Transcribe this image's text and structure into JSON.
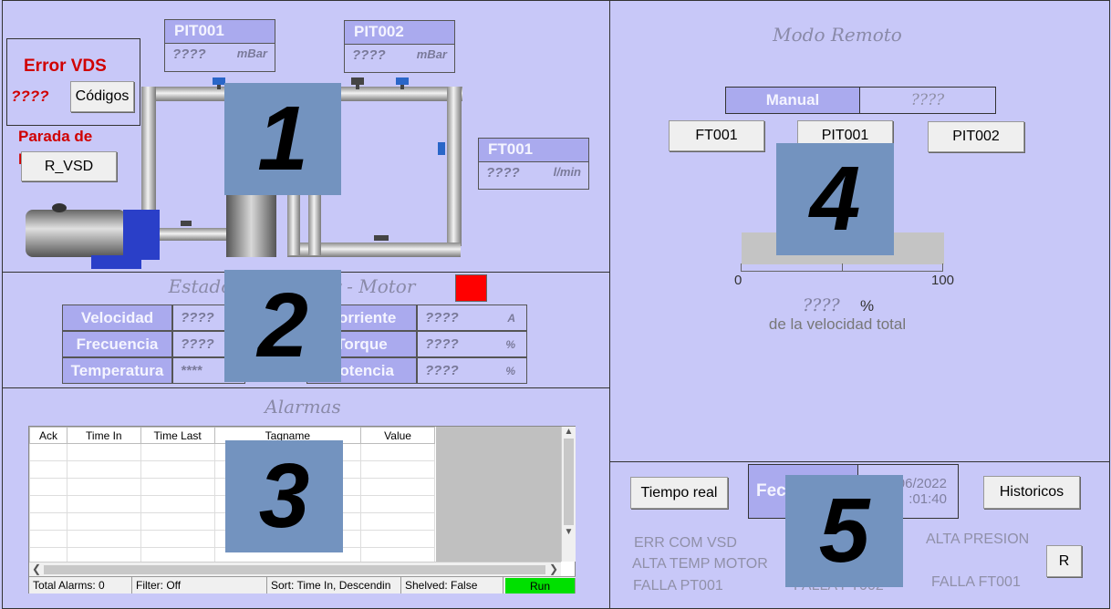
{
  "sections": {
    "motor_status_title": "Estado — Variador - Motor",
    "alarms_title": "Alarmas",
    "remote_mode_title": "Modo Remoto"
  },
  "error": {
    "title": "Error VDS",
    "value": "????",
    "codes_button": "Códigos",
    "stop_text": "Parada de Emergencia",
    "reset_button": "R_VSD"
  },
  "tags": {
    "pit001": {
      "name": "PIT001",
      "value": "????",
      "unit": "mBar"
    },
    "pit002": {
      "name": "PIT002",
      "value": "????",
      "unit": "mBar"
    },
    "ft001": {
      "name": "FT001",
      "value": "????",
      "unit": "l/min"
    }
  },
  "motor": {
    "status_color": "#ff0000",
    "left": [
      {
        "label": "Velocidad",
        "value": "????",
        "unit": ""
      },
      {
        "label": "Frecuencia",
        "value": "????",
        "unit": ""
      },
      {
        "label": "Temperatura",
        "value": "****",
        "unit": ""
      }
    ],
    "right": [
      {
        "label": "Corriente",
        "value": "????",
        "unit": "A"
      },
      {
        "label": "Torque",
        "value": "????",
        "unit": "%"
      },
      {
        "label": "Potencia",
        "value": "????",
        "unit": "%"
      }
    ]
  },
  "alarms": {
    "columns": [
      "Ack",
      "Time In",
      "Time Last",
      "Tagname",
      "Value"
    ],
    "status": {
      "total": "Total Alarms: 0",
      "filter": "Filter: Off",
      "sort": "Sort: Time In, Descendin",
      "shelved": "Shelved: False",
      "run": "Run"
    }
  },
  "remote": {
    "mode_label": "Manual",
    "mode_value": "????",
    "buttons": [
      "FT001",
      "PIT001",
      "PIT002"
    ],
    "bar_min": "0",
    "bar_max": "100",
    "bar_level": 0,
    "percent_value": "????",
    "percent_unit": "%",
    "percent_caption": "de la velocidad total"
  },
  "bottom": {
    "realtime_button": "Tiempo real",
    "date_label": "Fecha",
    "date_value": "06/2022",
    "time_value": ":01:40",
    "history_button": "Historicos",
    "reset_button": "R",
    "alarm_labels": {
      "err_com_vsd": "ERR COM VSD",
      "alta_temp_motor": "ALTA TEMP MOTOR",
      "falla_pt001": "FALLA PT001",
      "alta_presion": "ALTA PRESION",
      "falla_ft001": "FALLA FT001",
      "falla_pt002": "FALLA PT002"
    }
  },
  "overlays": [
    "1",
    "2",
    "3",
    "4",
    "5"
  ]
}
